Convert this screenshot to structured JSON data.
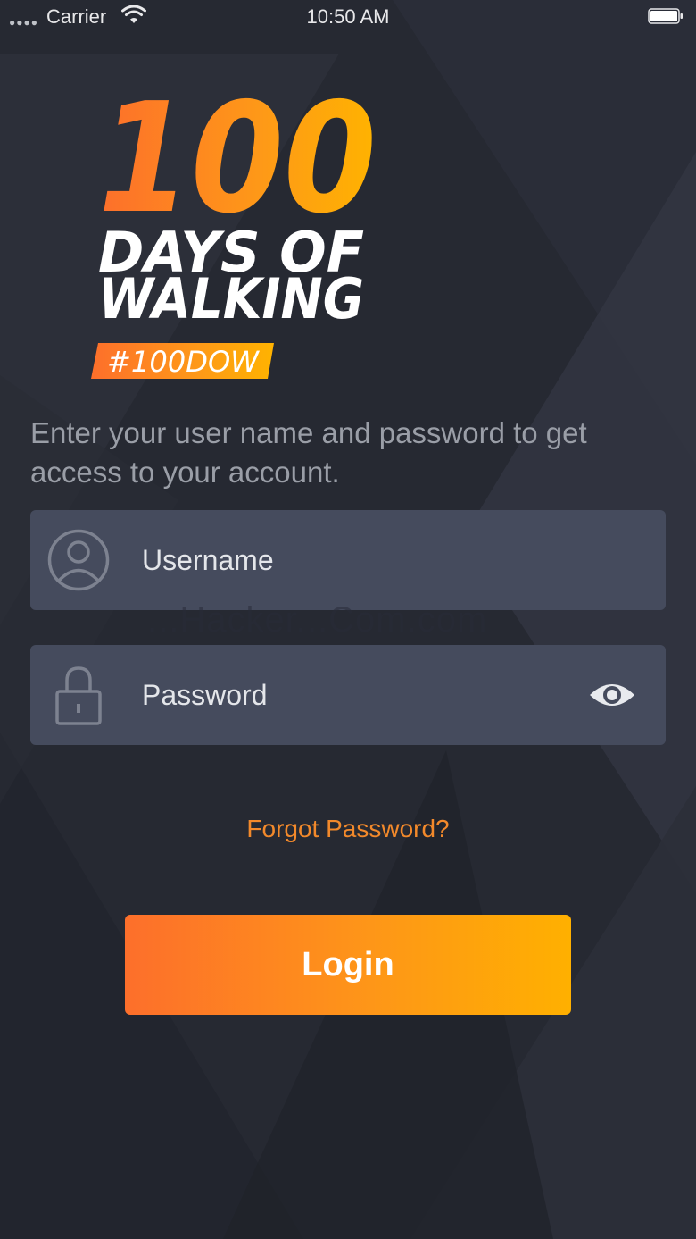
{
  "status_bar": {
    "carrier": "Carrier",
    "time": "10:50 AM"
  },
  "logo": {
    "number": "100",
    "line1": "DAYS OF",
    "line2": "WALKING",
    "hashtag": "#100DOW"
  },
  "intro_text": "Enter your user name and password to get access to your account.",
  "username": {
    "placeholder": "Username",
    "value": "",
    "icon": "user-circle-icon"
  },
  "password": {
    "placeholder": "Password",
    "value": "",
    "icon": "lock-icon",
    "toggle_icon": "eye-icon"
  },
  "watermark": "...Hacker...Com.com",
  "forgot_password_label": "Forgot Password?",
  "login_label": "Login",
  "colors": {
    "background": "#262932",
    "field_background": "#454b5d",
    "accent_orange": "#f2892b",
    "gradient_start": "#fd6f2b",
    "gradient_end": "#ffb000"
  }
}
